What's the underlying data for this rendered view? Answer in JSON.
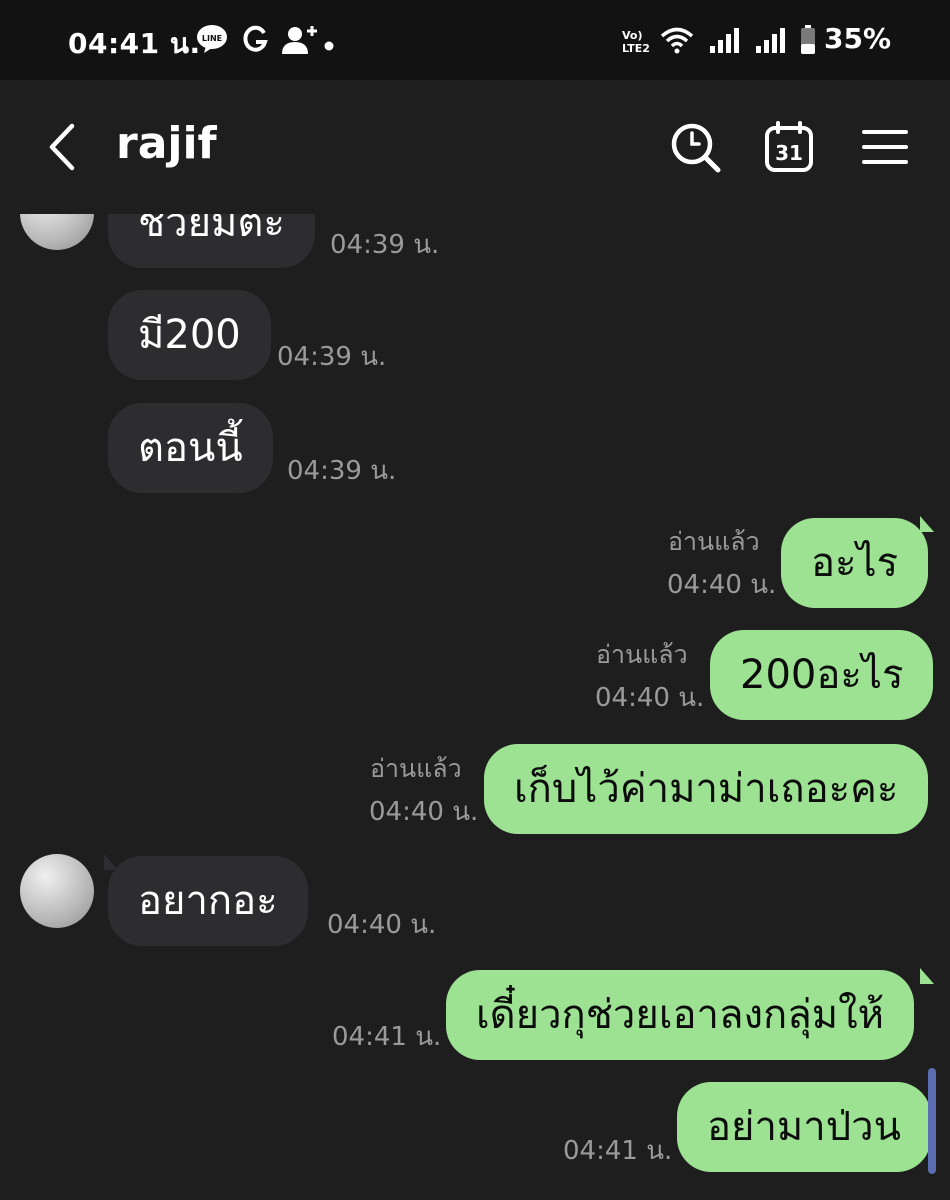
{
  "status_bar": {
    "time": "04:41 น.",
    "battery": "35%",
    "network_label": "Vo) LTE2",
    "icons": [
      "line-icon",
      "google-icon",
      "add-contact-icon",
      "wifi-icon",
      "signal-icon",
      "battery-icon"
    ]
  },
  "header": {
    "title": "rajif",
    "icons": [
      "back-icon",
      "search-icon",
      "calendar-icon",
      "menu-icon"
    ],
    "calendar_day": "31"
  },
  "messages": [
    {
      "side": "in",
      "text": "ช่วยมีตะ",
      "time": "04:39 น."
    },
    {
      "side": "in",
      "text": "มี200",
      "time": "04:39 น."
    },
    {
      "side": "in",
      "text": "ตอนนี้",
      "time": "04:39 น."
    },
    {
      "side": "out",
      "text": "อะไร",
      "time": "04:40 น.",
      "read": "อ่านแล้ว"
    },
    {
      "side": "out",
      "text": "200อะไร",
      "time": "04:40 น.",
      "read": "อ่านแล้ว"
    },
    {
      "side": "out",
      "text": "เก็บไว้ค่ามาม่าเถอะคะ",
      "time": "04:40 น.",
      "read": "อ่านแล้ว"
    },
    {
      "side": "in",
      "text": "อยากอะ",
      "time": "04:40 น."
    },
    {
      "side": "out",
      "text": "เดี๋ยวกุช่วยเอาลงกลุ่มให้",
      "time": "04:41 น."
    },
    {
      "side": "out",
      "text": "อย่ามาป่วน",
      "time": "04:41 น."
    }
  ],
  "colors": {
    "background": "#1e1e1e",
    "status_bar": "#121212",
    "incoming_bubble": "#2d2d2f",
    "outgoing_bubble": "#9de193"
  }
}
